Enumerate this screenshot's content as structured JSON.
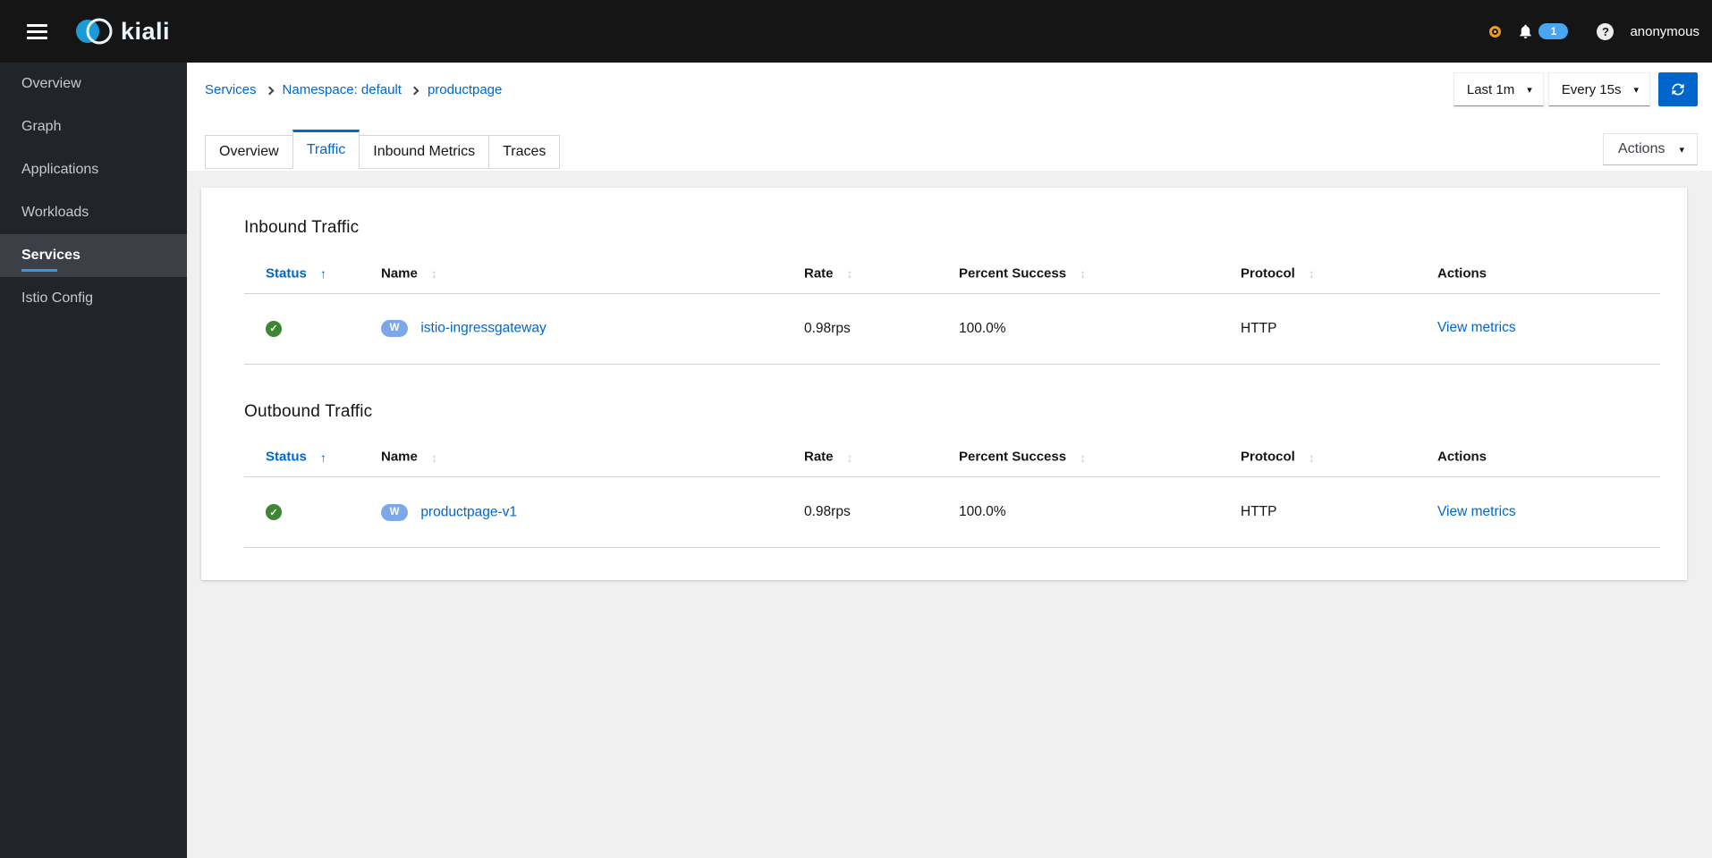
{
  "masthead": {
    "brand": "kiali",
    "notification_count": "1",
    "user": "anonymous"
  },
  "sidebar": {
    "items": [
      {
        "label": "Overview",
        "active": false
      },
      {
        "label": "Graph",
        "active": false
      },
      {
        "label": "Applications",
        "active": false
      },
      {
        "label": "Workloads",
        "active": false
      },
      {
        "label": "Services",
        "active": true
      },
      {
        "label": "Istio Config",
        "active": false
      }
    ]
  },
  "breadcrumb": {
    "items": [
      "Services",
      "Namespace: default",
      "productpage"
    ]
  },
  "toolbar": {
    "duration": "Last 1m",
    "refresh_interval": "Every 15s"
  },
  "actions": {
    "label": "Actions"
  },
  "tabs": [
    {
      "label": "Overview",
      "active": false
    },
    {
      "label": "Traffic",
      "active": true
    },
    {
      "label": "Inbound Metrics",
      "active": false
    },
    {
      "label": "Traces",
      "active": false
    }
  ],
  "traffic": {
    "columns": [
      "Status",
      "Name",
      "Rate",
      "Percent Success",
      "Protocol",
      "Actions"
    ],
    "sections": [
      {
        "title": "Inbound Traffic",
        "rows": [
          {
            "status": "healthy",
            "badge": "W",
            "name": "istio-ingressgateway",
            "rate": "0.98rps",
            "percent_success": "100.0%",
            "protocol": "HTTP",
            "action": "View metrics"
          }
        ]
      },
      {
        "title": "Outbound Traffic",
        "rows": [
          {
            "status": "healthy",
            "badge": "W",
            "name": "productpage-v1",
            "rate": "0.98rps",
            "percent_success": "100.0%",
            "protocol": "HTTP",
            "action": "View metrics"
          }
        ]
      }
    ]
  },
  "colors": {
    "accent_blue": "#0066cc",
    "masthead_bg": "#151515",
    "sidebar_bg": "#212529",
    "active_nav_underline": "#2b9af3",
    "success_green": "#3e8635",
    "workload_badge_blue": "#7ca7e8",
    "notification_badge_blue": "#4aa5f0",
    "istio_status_orange": "#f0ab00"
  }
}
